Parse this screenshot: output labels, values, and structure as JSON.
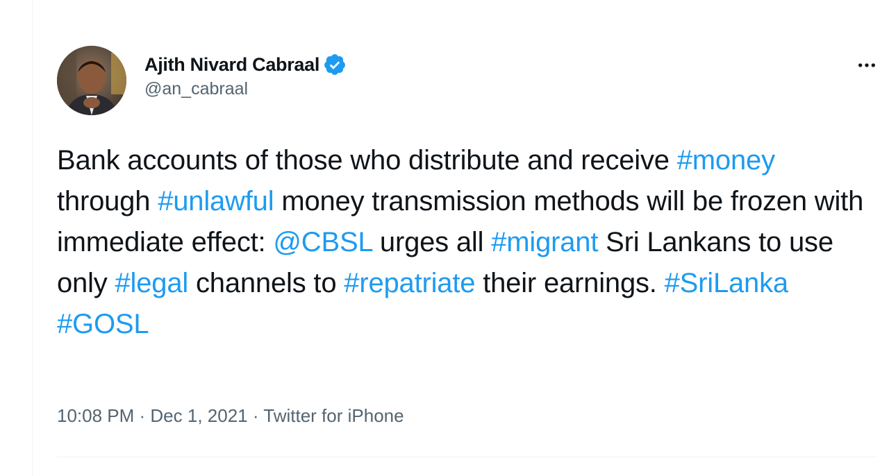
{
  "tweet": {
    "author": {
      "display_name": "Ajith Nivard Cabraal",
      "handle": "@an_cabraal",
      "verified": true
    },
    "more_label": "•••",
    "text_segments": [
      {
        "type": "text",
        "value": "Bank accounts of those who distribute and receive "
      },
      {
        "type": "hashtag",
        "value": "#money"
      },
      {
        "type": "text",
        "value": " through "
      },
      {
        "type": "hashtag",
        "value": "#unlawful"
      },
      {
        "type": "text",
        "value": " money transmission methods will be frozen with immediate effect: "
      },
      {
        "type": "mention",
        "value": "@CBSL"
      },
      {
        "type": "text",
        "value": " urges all "
      },
      {
        "type": "hashtag",
        "value": "#migrant"
      },
      {
        "type": "text",
        "value": " Sri Lankans to use only "
      },
      {
        "type": "hashtag",
        "value": "#legal"
      },
      {
        "type": "text",
        "value": " channels to "
      },
      {
        "type": "hashtag",
        "value": "#repatriate"
      },
      {
        "type": "text",
        "value": " their earnings. "
      },
      {
        "type": "hashtag",
        "value": "#SriLanka"
      },
      {
        "type": "text",
        "value": " "
      },
      {
        "type": "hashtag",
        "value": "#GOSL"
      }
    ],
    "meta": {
      "time": "10:08 PM",
      "separator": " · ",
      "date": "Dec 1, 2021",
      "source": "Twitter for iPhone"
    }
  },
  "colors": {
    "link": "#1d9bf0",
    "text": "#0f1419",
    "secondary": "#536471",
    "verified": "#1d9bf0"
  }
}
